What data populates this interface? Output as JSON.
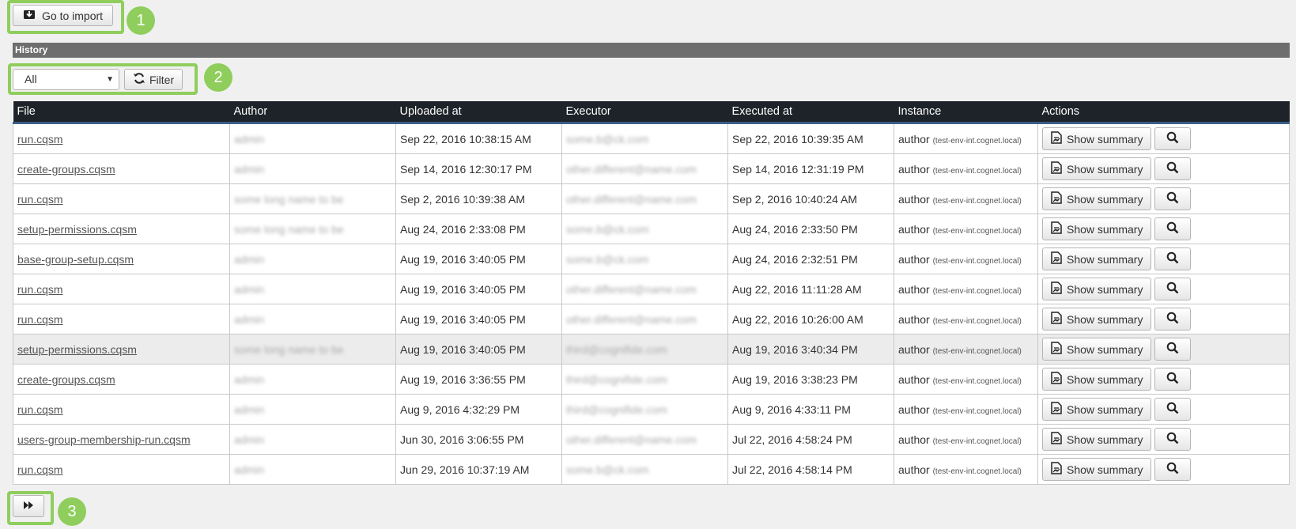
{
  "toolbar": {
    "import_label": "Go to import"
  },
  "history": {
    "title": "History"
  },
  "filter": {
    "selected": "All",
    "button_label": "Filter"
  },
  "table": {
    "columns": [
      "File",
      "Author",
      "Uploaded at",
      "Executor",
      "Executed at",
      "Instance",
      "Actions"
    ],
    "summary_label": "Show summary",
    "rows": [
      {
        "file": "run.cqsm",
        "author": "admin",
        "uploaded": "Sep 22, 2016 10:38:15 AM",
        "executor": "some.b@ck.com",
        "executed": "Sep 22, 2016 10:39:35 AM",
        "instance": "author",
        "host": "(test-env-int.cognet.local)"
      },
      {
        "file": "create-groups.cqsm",
        "author": "admin",
        "uploaded": "Sep 14, 2016 12:30:17 PM",
        "executor": "other.different@name.com",
        "executed": "Sep 14, 2016 12:31:19 PM",
        "instance": "author",
        "host": "(test-env-int.cognet.local)"
      },
      {
        "file": "run.cqsm",
        "author": "some long name to be",
        "uploaded": "Sep 2, 2016 10:39:38 AM",
        "executor": "other.different@name.com",
        "executed": "Sep 2, 2016 10:40:24 AM",
        "instance": "author",
        "host": "(test-env-int.cognet.local)"
      },
      {
        "file": "setup-permissions.cqsm",
        "author": "some long name to be",
        "uploaded": "Aug 24, 2016 2:33:08 PM",
        "executor": "some.b@ck.com",
        "executed": "Aug 24, 2016 2:33:50 PM",
        "instance": "author",
        "host": "(test-env-int.cognet.local)"
      },
      {
        "file": "base-group-setup.cqsm",
        "author": "admin",
        "uploaded": "Aug 19, 2016 3:40:05 PM",
        "executor": "some.b@ck.com",
        "executed": "Aug 24, 2016 2:32:51 PM",
        "instance": "author",
        "host": "(test-env-int.cognet.local)"
      },
      {
        "file": "run.cqsm",
        "author": "admin",
        "uploaded": "Aug 19, 2016 3:40:05 PM",
        "executor": "other.different@name.com",
        "executed": "Aug 22, 2016 11:11:28 AM",
        "instance": "author",
        "host": "(test-env-int.cognet.local)"
      },
      {
        "file": "run.cqsm",
        "author": "admin",
        "uploaded": "Aug 19, 2016 3:40:05 PM",
        "executor": "other.different@name.com",
        "executed": "Aug 22, 2016 10:26:00 AM",
        "instance": "author",
        "host": "(test-env-int.cognet.local)"
      },
      {
        "file": "setup-permissions.cqsm",
        "author": "some long name to be",
        "uploaded": "Aug 19, 2016 3:40:05 PM",
        "executor": "third@cognifide.com",
        "executed": "Aug 19, 2016 3:40:34 PM",
        "instance": "author",
        "host": "(test-env-int.cognet.local)"
      },
      {
        "file": "create-groups.cqsm",
        "author": "admin",
        "uploaded": "Aug 19, 2016 3:36:55 PM",
        "executor": "third@cognifide.com",
        "executed": "Aug 19, 2016 3:38:23 PM",
        "instance": "author",
        "host": "(test-env-int.cognet.local)"
      },
      {
        "file": "run.cqsm",
        "author": "admin",
        "uploaded": "Aug 9, 2016 4:32:29 PM",
        "executor": "third@cognifide.com",
        "executed": "Aug 9, 2016 4:33:11 PM",
        "instance": "author",
        "host": "(test-env-int.cognet.local)"
      },
      {
        "file": "users-group-membership-run.cqsm",
        "author": "admin",
        "uploaded": "Jun 30, 2016 3:06:55 PM",
        "executor": "other.different@name.com",
        "executed": "Jul 22, 2016 4:58:24 PM",
        "instance": "author",
        "host": "(test-env-int.cognet.local)"
      },
      {
        "file": "run.cqsm",
        "author": "admin",
        "uploaded": "Jun 29, 2016 10:37:19 AM",
        "executor": "some.b@ck.com",
        "executed": "Jul 22, 2016 4:58:14 PM",
        "instance": "author",
        "host": "(test-env-int.cognet.local)"
      }
    ]
  },
  "callouts": [
    "1",
    "2",
    "3"
  ],
  "colors": {
    "callout": "#8fce5c",
    "header": "#1e2329",
    "history_bar": "#6e6e6e"
  }
}
